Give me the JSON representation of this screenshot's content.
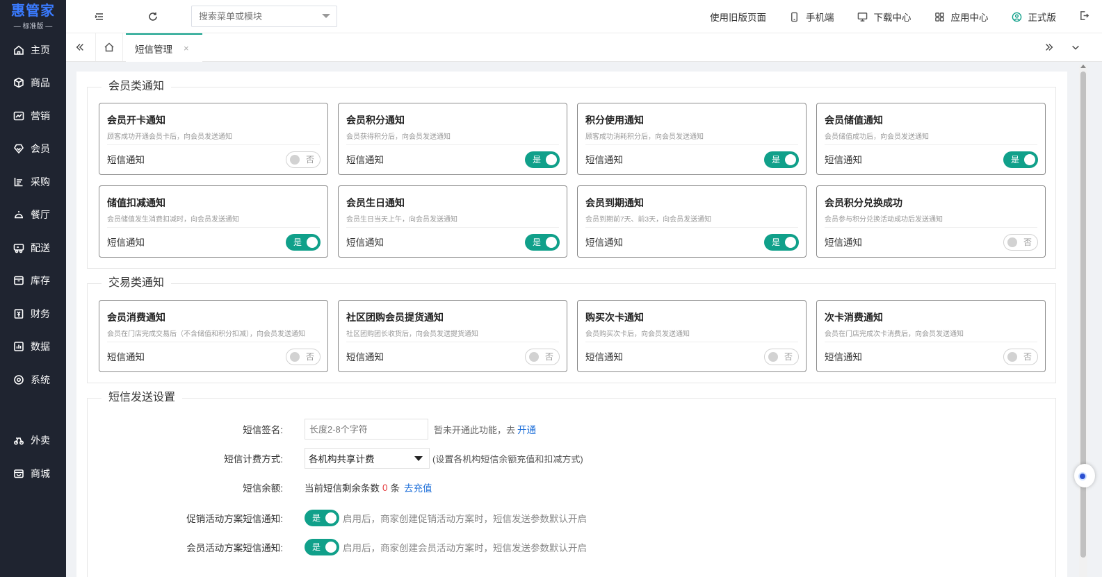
{
  "app": {
    "brand": "惠管家",
    "edition": "标准版"
  },
  "sidebar": {
    "items": [
      {
        "label": "主页",
        "icon": "home-icon"
      },
      {
        "label": "商品",
        "icon": "box-icon"
      },
      {
        "label": "营销",
        "icon": "chart-icon"
      },
      {
        "label": "会员",
        "icon": "diamond-icon"
      },
      {
        "label": "采购",
        "icon": "purchase-icon"
      },
      {
        "label": "餐厅",
        "icon": "dining-icon"
      },
      {
        "label": "配送",
        "icon": "delivery-icon"
      },
      {
        "label": "库存",
        "icon": "inventory-icon"
      },
      {
        "label": "财务",
        "icon": "finance-icon"
      },
      {
        "label": "数据",
        "icon": "data-icon"
      },
      {
        "label": "系统",
        "icon": "settings-icon"
      },
      {
        "label": "外卖",
        "icon": "takeout-icon"
      },
      {
        "label": "商城",
        "icon": "mall-icon"
      }
    ]
  },
  "topbar": {
    "search_placeholder": "搜索菜单或模块",
    "links": {
      "old_version": "使用旧版页面",
      "mobile": "手机端",
      "download": "下载中心",
      "apps": "应用中心",
      "user": "正式版"
    }
  },
  "tabs": {
    "active": "短信管理",
    "close": "×"
  },
  "sections": {
    "member": {
      "title": "会员类通知",
      "cards": [
        {
          "title": "会员开卡通知",
          "desc": "顾客成功开通会员卡后，向会员发送通知",
          "label": "短信通知",
          "on": false
        },
        {
          "title": "会员积分通知",
          "desc": "会员获得积分后，向会员发送通知",
          "label": "短信通知",
          "on": true
        },
        {
          "title": "积分使用通知",
          "desc": "顾客成功消耗积分后，向会员发送通知",
          "label": "短信通知",
          "on": true
        },
        {
          "title": "会员储值通知",
          "desc": "会员储值成功后，向会员发送通知",
          "label": "短信通知",
          "on": true
        },
        {
          "title": "储值扣减通知",
          "desc": "会员储值发生消费扣减时，向会员发送通知",
          "label": "短信通知",
          "on": true
        },
        {
          "title": "会员生日通知",
          "desc": "会员生日当天上午，向会员发送通知",
          "label": "短信通知",
          "on": true
        },
        {
          "title": "会员到期通知",
          "desc": "会员到期前7天、前3天，向会员发送通知",
          "label": "短信通知",
          "on": true
        },
        {
          "title": "会员积分兑换成功",
          "desc": "会员参与积分兑换活动成功后发送通知",
          "label": "短信通知",
          "on": false
        }
      ]
    },
    "trade": {
      "title": "交易类通知",
      "cards": [
        {
          "title": "会员消费通知",
          "desc": "会员在门店完成交易后（不含储值和积分扣减），向会员发送通知",
          "label": "短信通知",
          "on": false
        },
        {
          "title": "社区团购会员提货通知",
          "desc": "社区团购团长收货后，向会员发送提货通知",
          "label": "短信通知",
          "on": false
        },
        {
          "title": "购买次卡通知",
          "desc": "会员购买次卡后，向会员发送通知",
          "label": "短信通知",
          "on": false
        },
        {
          "title": "次卡消费通知",
          "desc": "会员在门店完成次卡消费后，向会员发送通知",
          "label": "短信通知",
          "on": false
        }
      ]
    },
    "switch": {
      "on_text": "是",
      "off_text": "否"
    },
    "settings": {
      "title": "短信发送设置",
      "signature": {
        "label": "短信签名:",
        "placeholder": "长度2-8个字符",
        "hint": "暂未开通此功能，去",
        "link": "开通"
      },
      "billing": {
        "label": "短信计费方式:",
        "value": "各机构共享计费",
        "hint": "(设置各机构短信余额充值和扣减方式)"
      },
      "balance": {
        "label": "短信余额:",
        "prefix": "当前短信剩余条数",
        "count": "0",
        "unit": "条",
        "link": "去充值"
      },
      "promo": {
        "label": "促销活动方案短信通知:",
        "on_text": "是",
        "desc": "启用后，商家创建促销活动方案时，短信发送参数默认开启"
      },
      "member_activity": {
        "label": "会员活动方案短信通知:",
        "on_text": "是",
        "desc": "启用后，商家创建会员活动方案时，短信发送参数默认开启"
      }
    }
  },
  "colors": {
    "accent": "#10a08a",
    "sidebar_bg": "#1f2430",
    "brand_blue": "#3a7bff",
    "link": "#1e6fd9",
    "alert": "#e4393c"
  }
}
